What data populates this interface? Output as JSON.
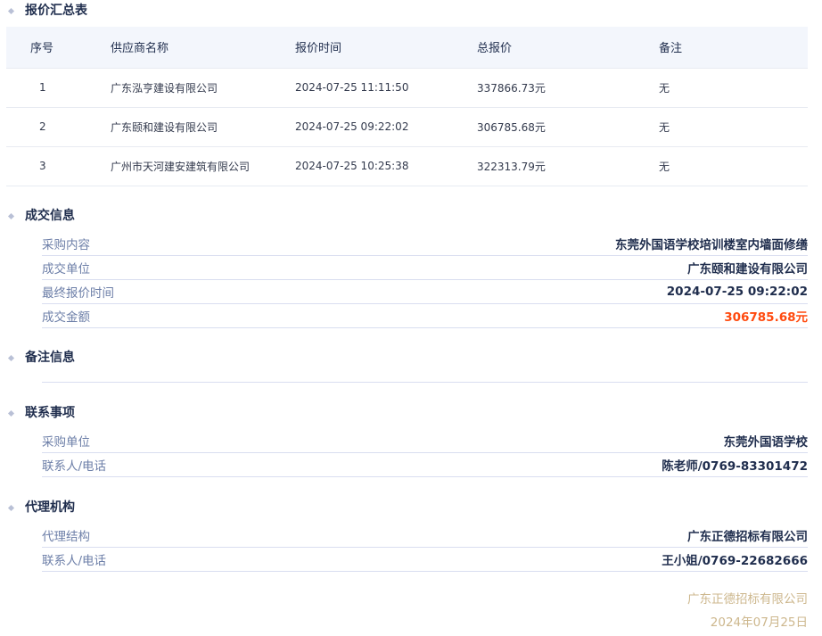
{
  "quote_summary": {
    "title": "报价汇总表",
    "columns": [
      "序号",
      "供应商名称",
      "报价时间",
      "总报价",
      "备注"
    ],
    "rows": [
      {
        "index": "1",
        "supplier": "广东泓亨建设有限公司",
        "time": "2024-07-25 11:11:50",
        "total": "337866.73元",
        "remark": "无"
      },
      {
        "index": "2",
        "supplier": "广东颐和建设有限公司",
        "time": "2024-07-25 09:22:02",
        "total": "306785.68元",
        "remark": "无"
      },
      {
        "index": "3",
        "supplier": "广州市天河建安建筑有限公司",
        "time": "2024-07-25 10:25:38",
        "total": "322313.79元",
        "remark": "无"
      }
    ]
  },
  "deal_info": {
    "title": "成交信息",
    "items": [
      {
        "label": "采购内容",
        "value": "东莞外国语学校培训楼室内墙面修缮"
      },
      {
        "label": "成交单位",
        "value": "广东颐和建设有限公司"
      },
      {
        "label": "最终报价时间",
        "value": "2024-07-25 09:22:02"
      },
      {
        "label": "成交金额",
        "value": "306785.68元"
      }
    ]
  },
  "remark_info": {
    "title": "备注信息"
  },
  "contact": {
    "title": "联系事项",
    "items": [
      {
        "label": "采购单位",
        "value": "东莞外国语学校"
      },
      {
        "label": "联系人/电话",
        "value": "陈老师/0769-83301472"
      }
    ]
  },
  "agency": {
    "title": "代理机构",
    "items": [
      {
        "label": "代理结构",
        "value": "广东正德招标有限公司"
      },
      {
        "label": "联系人/电话",
        "value": "王小姐/0769-22682666"
      }
    ]
  },
  "footer": {
    "company": "广东正德招标有限公司",
    "date": "2024年07月25日"
  },
  "colors": {
    "accent": "#ff4a0f",
    "label": "#6d7fa8",
    "footer": "#cdb78d"
  }
}
